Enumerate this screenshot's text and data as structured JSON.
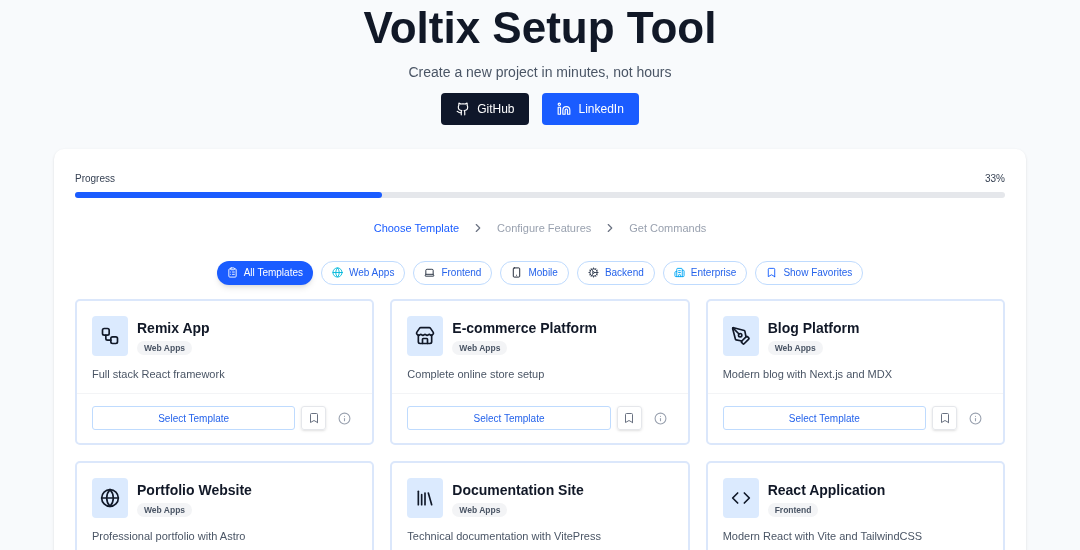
{
  "header": {
    "title": "Voltix Setup Tool",
    "subtitle": "Create a new project in minutes, not hours",
    "links": [
      {
        "kind": "github",
        "label": "GitHub"
      },
      {
        "kind": "linkedin",
        "label": "LinkedIn"
      }
    ]
  },
  "progress": {
    "label": "Progress",
    "reading": "33%",
    "level": 0.33
  },
  "steps": [
    {
      "label": "Choose Template",
      "selected": true
    },
    {
      "label": "Configure Features",
      "selected": false
    },
    {
      "label": "Get Commands",
      "selected": false
    }
  ],
  "filters": [
    {
      "kind": "clipboard",
      "label": "All Templates",
      "selected": true
    },
    {
      "kind": "globe",
      "label": "Web Apps",
      "selected": false
    },
    {
      "kind": "laptop",
      "label": "Frontend",
      "selected": false
    },
    {
      "kind": "phone",
      "label": "Mobile",
      "selected": false
    },
    {
      "kind": "gear",
      "label": "Backend",
      "selected": false
    },
    {
      "kind": "building",
      "label": "Enterprise",
      "selected": false
    },
    {
      "kind": "bookmark",
      "label": "Show Favorites",
      "selected": false
    }
  ],
  "templates": [
    {
      "kind": "workflow",
      "name": "Remix App",
      "tag": "Web Apps",
      "description": "Full stack React framework",
      "action": "Select Template"
    },
    {
      "kind": "store",
      "name": "E-commerce Platform",
      "tag": "Web Apps",
      "description": "Complete online store setup",
      "action": "Select Template"
    },
    {
      "kind": "pen",
      "name": "Blog Platform",
      "tag": "Web Apps",
      "description": "Modern blog with Next.js and MDX",
      "action": "Select Template"
    },
    {
      "kind": "globe",
      "name": "Portfolio Website",
      "tag": "Web Apps",
      "description": "Professional portfolio with Astro"
    },
    {
      "kind": "library",
      "name": "Documentation Site",
      "tag": "Web Apps",
      "description": "Technical documentation with VitePress"
    },
    {
      "kind": "code",
      "name": "React Application",
      "tag": "Frontend",
      "description": "Modern React with Vite and TailwindCSS"
    }
  ]
}
